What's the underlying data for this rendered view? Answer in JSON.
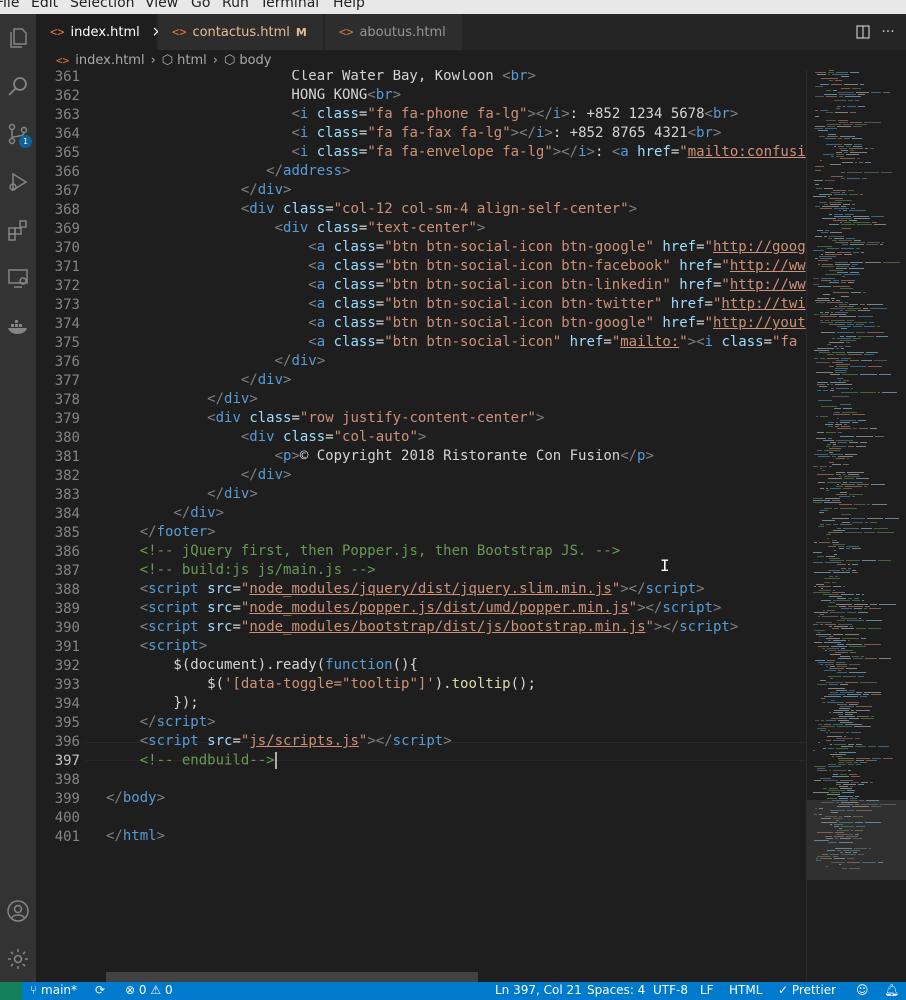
{
  "menu": [
    "File",
    "Edit",
    "Selection",
    "View",
    "Go",
    "Run",
    "Terminal",
    "Help"
  ],
  "activity": {
    "scm_badge": "1"
  },
  "tabs": [
    {
      "label": "index.html",
      "close": "×"
    },
    {
      "label": "contactus.html",
      "mod": "M"
    },
    {
      "label": "aboutus.html"
    }
  ],
  "breadcrumbs": [
    "index.html",
    "html",
    "body"
  ],
  "line_numbers": [
    "361",
    "362",
    "363",
    "364",
    "365",
    "366",
    "367",
    "368",
    "369",
    "370",
    "371",
    "372",
    "373",
    "374",
    "375",
    "376",
    "377",
    "378",
    "379",
    "380",
    "381",
    "382",
    "383",
    "384",
    "385",
    "386",
    "387",
    "388",
    "389",
    "390",
    "391",
    "392",
    "393",
    "394",
    "395",
    "396",
    "397",
    "398",
    "399",
    "400",
    "401"
  ],
  "current_line": "397",
  "code_lines": [
    [
      [
        "t-txt",
        "                      Clear Water Bay, Kowloon "
      ],
      [
        "t-br",
        "<"
      ],
      [
        "t-tag",
        "br"
      ],
      [
        "t-br",
        ">"
      ]
    ],
    [
      [
        "t-txt",
        "                      HONG KONG"
      ],
      [
        "t-br",
        "<"
      ],
      [
        "t-tag",
        "br"
      ],
      [
        "t-br",
        ">"
      ]
    ],
    [
      [
        "t-txt",
        "                      "
      ],
      [
        "t-br",
        "<"
      ],
      [
        "t-tag",
        "i"
      ],
      [
        "t-txt",
        " "
      ],
      [
        "t-attr",
        "class"
      ],
      [
        "t-txt",
        "="
      ],
      [
        "t-str",
        "\"fa fa-phone fa-lg\""
      ],
      [
        "t-br",
        "></"
      ],
      [
        "t-tag",
        "i"
      ],
      [
        "t-br",
        ">"
      ],
      [
        "t-txt",
        ": +852 1234 5678"
      ],
      [
        "t-br",
        "<"
      ],
      [
        "t-tag",
        "br"
      ],
      [
        "t-br",
        ">"
      ]
    ],
    [
      [
        "t-txt",
        "                      "
      ],
      [
        "t-br",
        "<"
      ],
      [
        "t-tag",
        "i"
      ],
      [
        "t-txt",
        " "
      ],
      [
        "t-attr",
        "class"
      ],
      [
        "t-txt",
        "="
      ],
      [
        "t-str",
        "\"fa fa-fax fa-lg\""
      ],
      [
        "t-br",
        "></"
      ],
      [
        "t-tag",
        "i"
      ],
      [
        "t-br",
        ">"
      ],
      [
        "t-txt",
        ": +852 8765 4321"
      ],
      [
        "t-br",
        "<"
      ],
      [
        "t-tag",
        "br"
      ],
      [
        "t-br",
        ">"
      ]
    ],
    [
      [
        "t-txt",
        "                      "
      ],
      [
        "t-br",
        "<"
      ],
      [
        "t-tag",
        "i"
      ],
      [
        "t-txt",
        " "
      ],
      [
        "t-attr",
        "class"
      ],
      [
        "t-txt",
        "="
      ],
      [
        "t-str",
        "\"fa fa-envelope fa-lg\""
      ],
      [
        "t-br",
        "></"
      ],
      [
        "t-tag",
        "i"
      ],
      [
        "t-br",
        ">"
      ],
      [
        "t-txt",
        ": "
      ],
      [
        "t-br",
        "<"
      ],
      [
        "t-tag",
        "a"
      ],
      [
        "t-txt",
        " "
      ],
      [
        "t-attr",
        "href"
      ],
      [
        "t-txt",
        "="
      ],
      [
        "t-str",
        "\""
      ],
      [
        "t-str t-u",
        "mailto:confusi"
      ]
    ],
    [
      [
        "t-txt",
        "                   "
      ],
      [
        "t-br",
        "</"
      ],
      [
        "t-tag",
        "address"
      ],
      [
        "t-br",
        ">"
      ]
    ],
    [
      [
        "t-txt",
        "                "
      ],
      [
        "t-br",
        "</"
      ],
      [
        "t-tag",
        "div"
      ],
      [
        "t-br",
        ">"
      ]
    ],
    [
      [
        "t-txt",
        "                "
      ],
      [
        "t-br",
        "<"
      ],
      [
        "t-tag",
        "div"
      ],
      [
        "t-txt",
        " "
      ],
      [
        "t-attr",
        "class"
      ],
      [
        "t-txt",
        "="
      ],
      [
        "t-str",
        "\"col-12 col-sm-4 align-self-center\""
      ],
      [
        "t-br",
        ">"
      ]
    ],
    [
      [
        "t-txt",
        "                    "
      ],
      [
        "t-br",
        "<"
      ],
      [
        "t-tag",
        "div"
      ],
      [
        "t-txt",
        " "
      ],
      [
        "t-attr",
        "class"
      ],
      [
        "t-txt",
        "="
      ],
      [
        "t-str",
        "\"text-center\""
      ],
      [
        "t-br",
        ">"
      ]
    ],
    [
      [
        "t-txt",
        "                        "
      ],
      [
        "t-br",
        "<"
      ],
      [
        "t-tag",
        "a"
      ],
      [
        "t-txt",
        " "
      ],
      [
        "t-attr",
        "class"
      ],
      [
        "t-txt",
        "="
      ],
      [
        "t-str",
        "\"btn btn-social-icon btn-google\""
      ],
      [
        "t-txt",
        " "
      ],
      [
        "t-attr",
        "href"
      ],
      [
        "t-txt",
        "="
      ],
      [
        "t-str",
        "\""
      ],
      [
        "t-str t-u",
        "http://goog"
      ]
    ],
    [
      [
        "t-txt",
        "                        "
      ],
      [
        "t-br",
        "<"
      ],
      [
        "t-tag",
        "a"
      ],
      [
        "t-txt",
        " "
      ],
      [
        "t-attr",
        "class"
      ],
      [
        "t-txt",
        "="
      ],
      [
        "t-str",
        "\"btn btn-social-icon btn-facebook\""
      ],
      [
        "t-txt",
        " "
      ],
      [
        "t-attr",
        "href"
      ],
      [
        "t-txt",
        "="
      ],
      [
        "t-str",
        "\""
      ],
      [
        "t-str t-u",
        "http://ww"
      ]
    ],
    [
      [
        "t-txt",
        "                        "
      ],
      [
        "t-br",
        "<"
      ],
      [
        "t-tag",
        "a"
      ],
      [
        "t-txt",
        " "
      ],
      [
        "t-attr",
        "class"
      ],
      [
        "t-txt",
        "="
      ],
      [
        "t-str",
        "\"btn btn-social-icon btn-linkedin\""
      ],
      [
        "t-txt",
        " "
      ],
      [
        "t-attr",
        "href"
      ],
      [
        "t-txt",
        "="
      ],
      [
        "t-str",
        "\""
      ],
      [
        "t-str t-u",
        "http://ww"
      ]
    ],
    [
      [
        "t-txt",
        "                        "
      ],
      [
        "t-br",
        "<"
      ],
      [
        "t-tag",
        "a"
      ],
      [
        "t-txt",
        " "
      ],
      [
        "t-attr",
        "class"
      ],
      [
        "t-txt",
        "="
      ],
      [
        "t-str",
        "\"btn btn-social-icon btn-twitter\""
      ],
      [
        "t-txt",
        " "
      ],
      [
        "t-attr",
        "href"
      ],
      [
        "t-txt",
        "="
      ],
      [
        "t-str",
        "\""
      ],
      [
        "t-str t-u",
        "http://twi"
      ]
    ],
    [
      [
        "t-txt",
        "                        "
      ],
      [
        "t-br",
        "<"
      ],
      [
        "t-tag",
        "a"
      ],
      [
        "t-txt",
        " "
      ],
      [
        "t-attr",
        "class"
      ],
      [
        "t-txt",
        "="
      ],
      [
        "t-str",
        "\"btn btn-social-icon btn-google\""
      ],
      [
        "t-txt",
        " "
      ],
      [
        "t-attr",
        "href"
      ],
      [
        "t-txt",
        "="
      ],
      [
        "t-str",
        "\""
      ],
      [
        "t-str t-u",
        "http://yout"
      ]
    ],
    [
      [
        "t-txt",
        "                        "
      ],
      [
        "t-br",
        "<"
      ],
      [
        "t-tag",
        "a"
      ],
      [
        "t-txt",
        " "
      ],
      [
        "t-attr",
        "class"
      ],
      [
        "t-txt",
        "="
      ],
      [
        "t-str",
        "\"btn btn-social-icon\""
      ],
      [
        "t-txt",
        " "
      ],
      [
        "t-attr",
        "href"
      ],
      [
        "t-txt",
        "="
      ],
      [
        "t-str",
        "\""
      ],
      [
        "t-str t-u",
        "mailto:"
      ],
      [
        "t-str",
        "\""
      ],
      [
        "t-br",
        "><"
      ],
      [
        "t-tag",
        "i"
      ],
      [
        "t-txt",
        " "
      ],
      [
        "t-attr",
        "class"
      ],
      [
        "t-txt",
        "="
      ],
      [
        "t-str",
        "\"fa"
      ]
    ],
    [
      [
        "t-txt",
        "                    "
      ],
      [
        "t-br",
        "</"
      ],
      [
        "t-tag",
        "div"
      ],
      [
        "t-br",
        ">"
      ]
    ],
    [
      [
        "t-txt",
        "                "
      ],
      [
        "t-br",
        "</"
      ],
      [
        "t-tag",
        "div"
      ],
      [
        "t-br",
        ">"
      ]
    ],
    [
      [
        "t-txt",
        "            "
      ],
      [
        "t-br",
        "</"
      ],
      [
        "t-tag",
        "div"
      ],
      [
        "t-br",
        ">"
      ]
    ],
    [
      [
        "t-txt",
        "            "
      ],
      [
        "t-br",
        "<"
      ],
      [
        "t-tag",
        "div"
      ],
      [
        "t-txt",
        " "
      ],
      [
        "t-attr",
        "class"
      ],
      [
        "t-txt",
        "="
      ],
      [
        "t-str",
        "\"row justify-content-center\""
      ],
      [
        "t-br",
        ">"
      ]
    ],
    [
      [
        "t-txt",
        "                "
      ],
      [
        "t-br",
        "<"
      ],
      [
        "t-tag",
        "div"
      ],
      [
        "t-txt",
        " "
      ],
      [
        "t-attr",
        "class"
      ],
      [
        "t-txt",
        "="
      ],
      [
        "t-str",
        "\"col-auto\""
      ],
      [
        "t-br",
        ">"
      ]
    ],
    [
      [
        "t-txt",
        "                    "
      ],
      [
        "t-br",
        "<"
      ],
      [
        "t-tag",
        "p"
      ],
      [
        "t-br",
        ">"
      ],
      [
        "t-txt",
        "© Copyright 2018 Ristorante Con Fusion"
      ],
      [
        "t-br",
        "</"
      ],
      [
        "t-tag",
        "p"
      ],
      [
        "t-br",
        ">"
      ]
    ],
    [
      [
        "t-txt",
        "                "
      ],
      [
        "t-br",
        "</"
      ],
      [
        "t-tag",
        "div"
      ],
      [
        "t-br",
        ">"
      ]
    ],
    [
      [
        "t-txt",
        "            "
      ],
      [
        "t-br",
        "</"
      ],
      [
        "t-tag",
        "div"
      ],
      [
        "t-br",
        ">"
      ]
    ],
    [
      [
        "t-txt",
        "        "
      ],
      [
        "t-br",
        "</"
      ],
      [
        "t-tag",
        "div"
      ],
      [
        "t-br",
        ">"
      ]
    ],
    [
      [
        "t-txt",
        "    "
      ],
      [
        "t-br",
        "</"
      ],
      [
        "t-tag",
        "footer"
      ],
      [
        "t-br",
        ">"
      ]
    ],
    [
      [
        "t-txt",
        "    "
      ],
      [
        "t-cm",
        "<!-- jQuery first, then Popper.js, then Bootstrap JS. -->"
      ]
    ],
    [
      [
        "t-txt",
        "    "
      ],
      [
        "t-cm",
        "<!-- build:js js/main.js -->"
      ]
    ],
    [
      [
        "t-txt",
        "    "
      ],
      [
        "t-br",
        "<"
      ],
      [
        "t-tag",
        "script"
      ],
      [
        "t-txt",
        " "
      ],
      [
        "t-attr",
        "src"
      ],
      [
        "t-txt",
        "="
      ],
      [
        "t-str",
        "\""
      ],
      [
        "t-str t-u",
        "node_modules/jquery/dist/jquery.slim.min.js"
      ],
      [
        "t-str",
        "\""
      ],
      [
        "t-br",
        "></"
      ],
      [
        "t-tag",
        "script"
      ],
      [
        "t-br",
        ">"
      ]
    ],
    [
      [
        "t-txt",
        "    "
      ],
      [
        "t-br",
        "<"
      ],
      [
        "t-tag",
        "script"
      ],
      [
        "t-txt",
        " "
      ],
      [
        "t-attr",
        "src"
      ],
      [
        "t-txt",
        "="
      ],
      [
        "t-str",
        "\""
      ],
      [
        "t-str t-u",
        "node_modules/popper.js/dist/umd/popper.min.js"
      ],
      [
        "t-str",
        "\""
      ],
      [
        "t-br",
        "></"
      ],
      [
        "t-tag",
        "script"
      ],
      [
        "t-br",
        ">"
      ]
    ],
    [
      [
        "t-txt",
        "    "
      ],
      [
        "t-br",
        "<"
      ],
      [
        "t-tag",
        "script"
      ],
      [
        "t-txt",
        " "
      ],
      [
        "t-attr",
        "src"
      ],
      [
        "t-txt",
        "="
      ],
      [
        "t-str",
        "\""
      ],
      [
        "t-str t-u",
        "node_modules/bootstrap/dist/js/bootstrap.min.js"
      ],
      [
        "t-str",
        "\""
      ],
      [
        "t-br",
        "></"
      ],
      [
        "t-tag",
        "script"
      ],
      [
        "t-br",
        ">"
      ]
    ],
    [
      [
        "t-txt",
        "    "
      ],
      [
        "t-br",
        "<"
      ],
      [
        "t-tag",
        "script"
      ],
      [
        "t-br",
        ">"
      ]
    ],
    [
      [
        "t-txt",
        "        $(document).ready("
      ],
      [
        "t-tag",
        "function"
      ],
      [
        "t-txt",
        "(){"
      ]
    ],
    [
      [
        "t-txt",
        "            $("
      ],
      [
        "t-str",
        "'[data-toggle=\"tooltip\"]'"
      ],
      [
        "t-txt",
        ")."
      ],
      [
        "t-fn",
        "tooltip"
      ],
      [
        "t-txt",
        "();"
      ]
    ],
    [
      [
        "t-txt",
        "        });"
      ]
    ],
    [
      [
        "t-txt",
        "    "
      ],
      [
        "t-br",
        "</"
      ],
      [
        "t-tag",
        "script"
      ],
      [
        "t-br",
        ">"
      ]
    ],
    [
      [
        "t-txt",
        "    "
      ],
      [
        "t-br",
        "<"
      ],
      [
        "t-tag",
        "script"
      ],
      [
        "t-txt",
        " "
      ],
      [
        "t-attr",
        "src"
      ],
      [
        "t-txt",
        "="
      ],
      [
        "t-str",
        "\""
      ],
      [
        "t-str t-u",
        "js/scripts.js"
      ],
      [
        "t-str",
        "\""
      ],
      [
        "t-br",
        "></"
      ],
      [
        "t-tag",
        "script"
      ],
      [
        "t-br",
        ">"
      ]
    ],
    [
      [
        "t-txt",
        "    "
      ],
      [
        "t-cm",
        "<!-- endbuild-->"
      ]
    ],
    [],
    [
      [
        "t-br",
        "</"
      ],
      [
        "t-tag",
        "body"
      ],
      [
        "t-br",
        ">"
      ]
    ],
    [],
    [
      [
        "t-br",
        "</"
      ],
      [
        "t-tag",
        "html"
      ],
      [
        "t-br",
        ">"
      ]
    ]
  ],
  "status": {
    "branch": "main*",
    "errors": "0",
    "warnings": "0",
    "position": "Ln 397, Col 21",
    "spaces": "Spaces: 4",
    "encoding": "UTF-8",
    "eol": "LF",
    "language": "HTML",
    "formatter": "Prettier"
  },
  "colors": {
    "status_bar": "#007acc",
    "tag": "#569cd6",
    "attr": "#9cdcfe",
    "string": "#ce9178",
    "comment": "#6a9955"
  }
}
